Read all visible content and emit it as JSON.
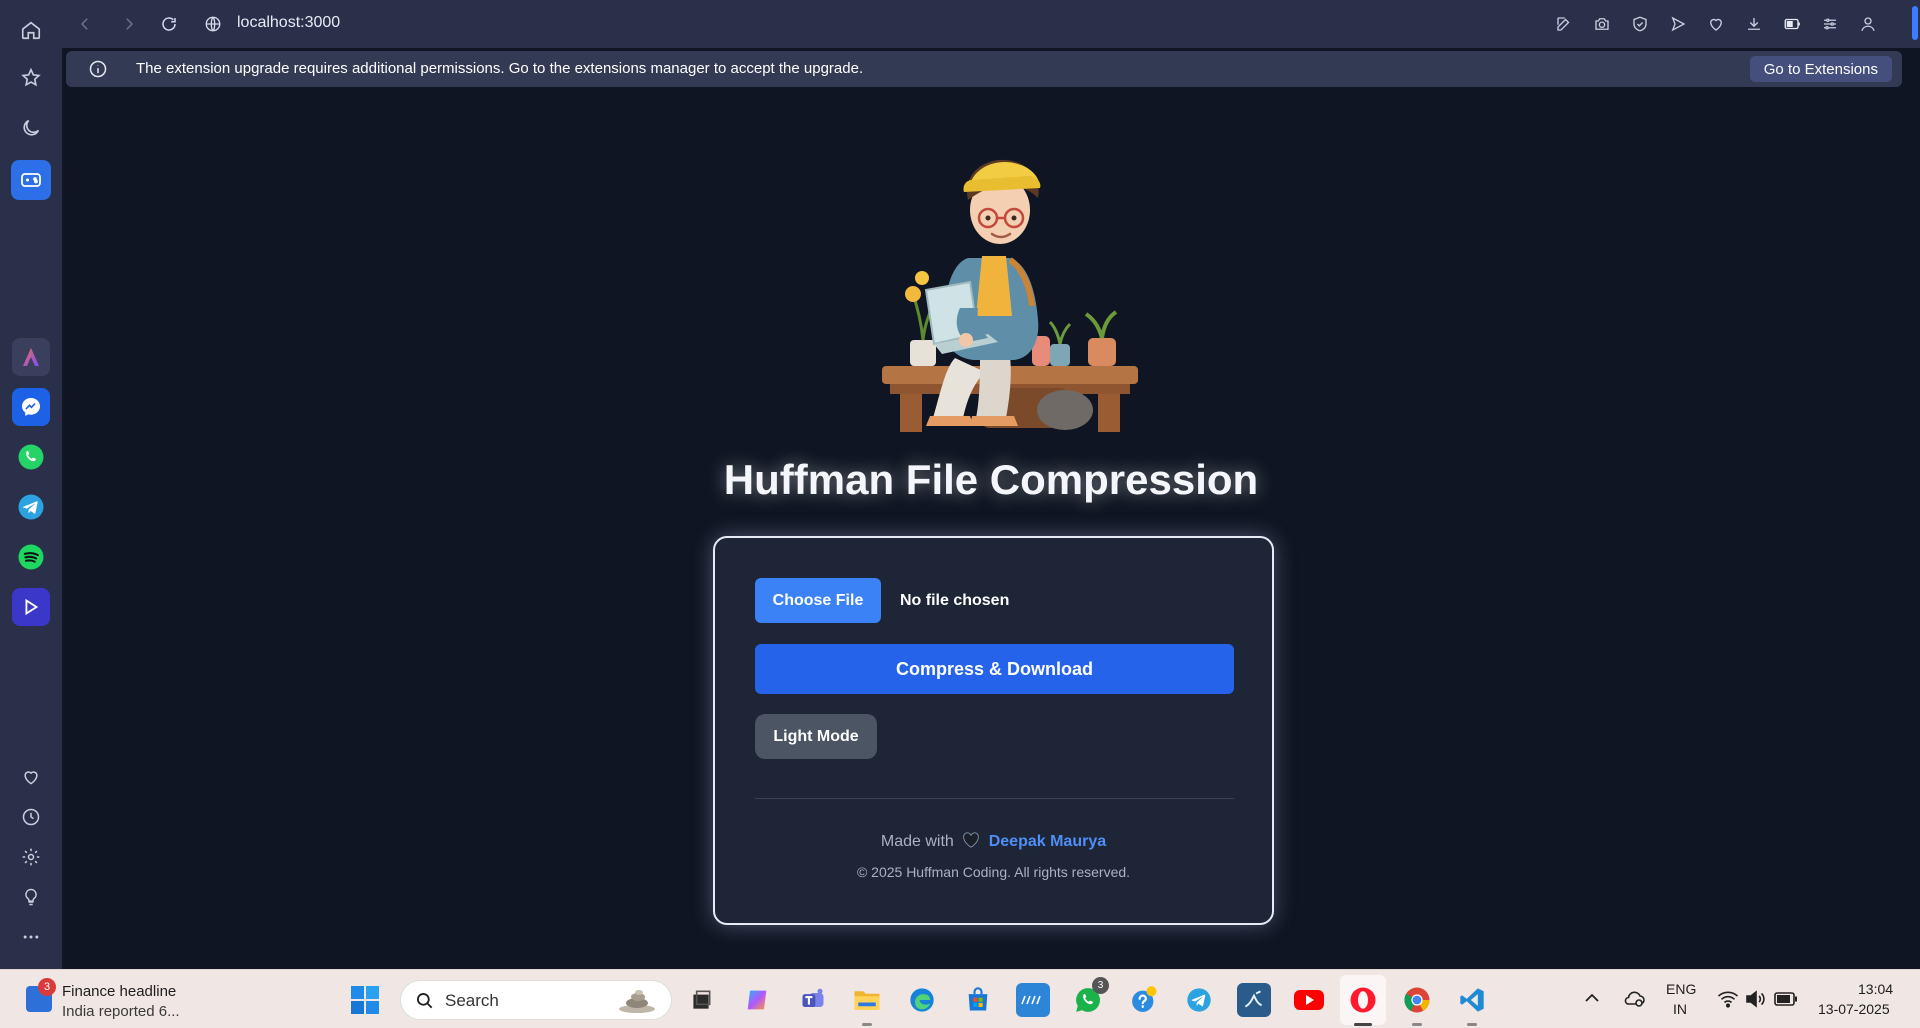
{
  "browser": {
    "url": "localhost:3000",
    "notice": {
      "message": "The extension upgrade requires additional permissions. Go to the extensions manager to accept the upgrade.",
      "button": "Go to Extensions"
    }
  },
  "page": {
    "title": "Huffman File Compression",
    "file_input": {
      "button": "Choose File",
      "status": "No file chosen"
    },
    "compress_button": "Compress & Download",
    "mode_button": "Light Mode",
    "footer": {
      "made_with": "Made with",
      "author": "Deepak Maurya",
      "copyright": "© 2025 Huffman Coding. All rights reserved."
    }
  },
  "taskbar": {
    "news": {
      "badge": "3",
      "title": "Finance headline",
      "subtitle": "India reported 6..."
    },
    "search_label": "Search",
    "whatsapp_badge": "3",
    "language": {
      "line1": "ENG",
      "line2": "IN"
    },
    "clock": {
      "time": "13:04",
      "date": "13-07-2025"
    }
  },
  "colors": {
    "page_bg": "#0f1522",
    "card_bg": "#1e2536",
    "primary": "#2563eb",
    "choose": "#3b82f6",
    "secondary": "#4b5563",
    "link": "#4f8ef7",
    "chrome": "#2a3049"
  }
}
